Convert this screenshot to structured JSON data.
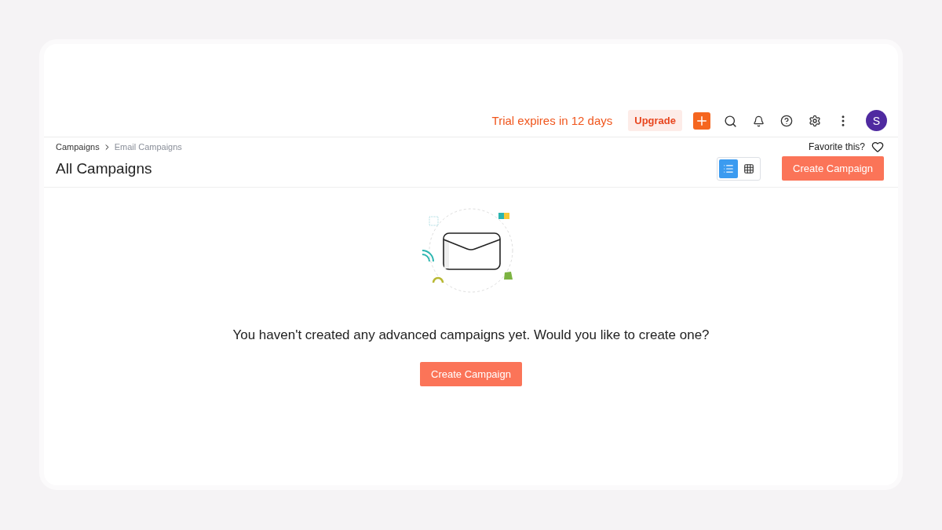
{
  "header": {
    "trial_notice": "Trial expires in 12 days",
    "upgrade_button": "Upgrade",
    "avatar_initial": "S"
  },
  "breadcrumb": [
    {
      "label": "Campaigns",
      "current": false
    },
    {
      "label": "Email Campaigns",
      "current": true
    }
  ],
  "favorite": {
    "label": "Favorite this?",
    "on": false
  },
  "title": "All Campaigns",
  "view_toggle": [
    {
      "kind": "list",
      "selected": true
    },
    {
      "kind": "grid",
      "selected": false
    }
  ],
  "create_button": "Create Campaign",
  "empty_state": {
    "message": "You haven't created any advanced campaigns yet. Would you like to create one?",
    "button": "Create Campaign"
  }
}
